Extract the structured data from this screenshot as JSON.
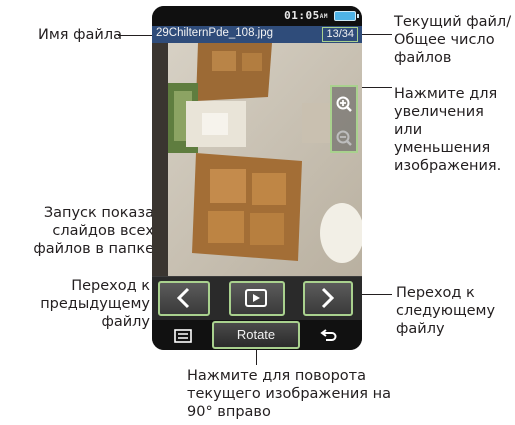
{
  "device": {
    "clock": "01:05",
    "ampm": "AM",
    "filename": "29ChilternPde_108.jpg",
    "counter": "13/34",
    "rotate_label": "Rotate"
  },
  "annotations": {
    "filename": "Имя файла",
    "current_file": [
      "Текущий файл/",
      "Общее число",
      "файлов"
    ],
    "zoom": [
      "Нажмите для",
      "увеличения или",
      "уменьшения",
      "изображения."
    ],
    "slideshow": [
      "Запуск показа",
      "слайдов всех",
      "файлов в папке"
    ],
    "prev": [
      "Переход к",
      "предыдущему",
      "файлу"
    ],
    "next": [
      "Переход к",
      "следующему",
      "файлу"
    ],
    "rotate": [
      "Нажмите для поворота",
      "текущего изображения на",
      "90° вправо"
    ]
  },
  "colors": {
    "highlight": "#a9d18e",
    "filebar": "#2f4c7a",
    "battery": "#4fb3e6"
  },
  "icons": [
    "zoom-in-icon",
    "zoom-out-icon",
    "chevron-left-icon",
    "play-icon",
    "chevron-right-icon",
    "menu-icon",
    "back-icon"
  ]
}
